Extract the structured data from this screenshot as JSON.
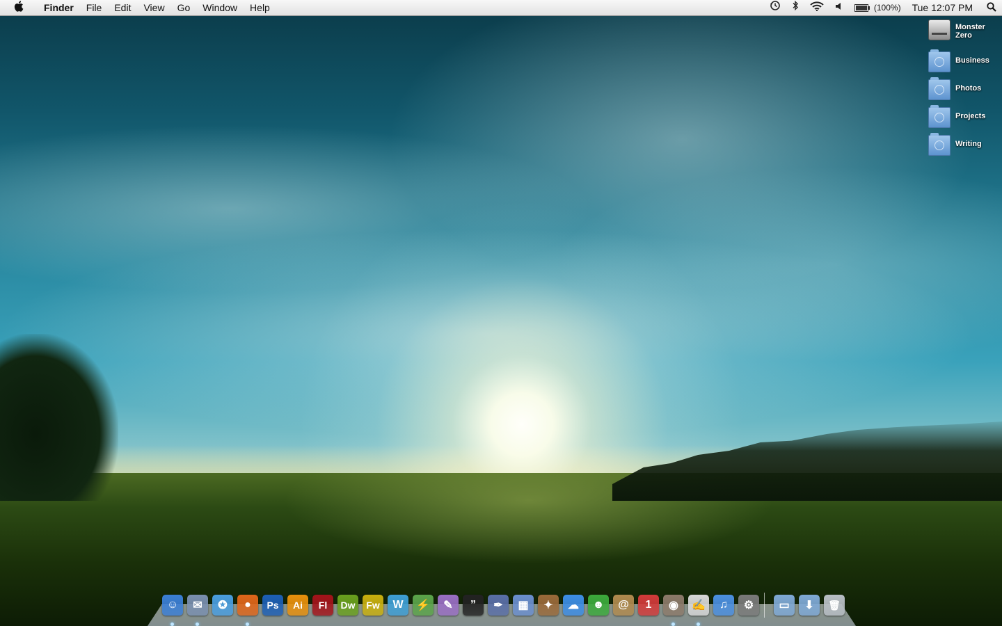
{
  "menubar": {
    "apple_icon": "apple-logo-icon",
    "app_name": "Finder",
    "menus": [
      "File",
      "Edit",
      "View",
      "Go",
      "Window",
      "Help"
    ],
    "status": {
      "time_machine_icon": "time-machine-icon",
      "bluetooth_icon": "bluetooth-icon",
      "wifi_icon": "wifi-icon",
      "volume_icon": "volume-icon",
      "battery_icon": "battery-icon",
      "battery_percent": "(100%)",
      "battery_level": 1.0,
      "clock": "Tue 12:07 PM",
      "spotlight_icon": "spotlight-icon"
    }
  },
  "desktop": {
    "items": [
      {
        "label": "Monster Zero",
        "kind": "hard-disk"
      },
      {
        "label": "Business",
        "kind": "folder"
      },
      {
        "label": "Photos",
        "kind": "folder"
      },
      {
        "label": "Projects",
        "kind": "folder"
      },
      {
        "label": "Writing",
        "kind": "folder"
      }
    ]
  },
  "dock": {
    "apps": [
      {
        "icon": "finder-icon",
        "glyph": "☺",
        "color": "#3b7fd6",
        "running": true
      },
      {
        "icon": "mail-icon",
        "glyph": "✉",
        "color": "#7a8fb0",
        "running": true
      },
      {
        "icon": "safari-icon",
        "glyph": "✪",
        "color": "#4a9ee0",
        "running": false
      },
      {
        "icon": "firefox-icon",
        "glyph": "●",
        "color": "#e0661a",
        "running": true
      },
      {
        "icon": "photoshop-icon",
        "glyph": "Ps",
        "color": "#1d5fb5",
        "running": false
      },
      {
        "icon": "illustrator-icon",
        "glyph": "Ai",
        "color": "#e8900c",
        "running": false
      },
      {
        "icon": "flash-icon",
        "glyph": "Fl",
        "color": "#a3131a",
        "running": false
      },
      {
        "icon": "dreamweaver-icon",
        "glyph": "Dw",
        "color": "#6aa01e",
        "running": false
      },
      {
        "icon": "fireworks-icon",
        "glyph": "Fw",
        "color": "#c9b00e",
        "running": false
      },
      {
        "icon": "coda-icon",
        "glyph": "W",
        "color": "#3e9fd6",
        "running": false
      },
      {
        "icon": "transmit-icon",
        "glyph": "⚡",
        "color": "#5ba44a",
        "running": false
      },
      {
        "icon": "textmate-icon",
        "glyph": "✎",
        "color": "#9a6fc4",
        "running": false
      },
      {
        "icon": "quote-icon",
        "glyph": "”",
        "color": "#222222",
        "running": false
      },
      {
        "icon": "script-editor-icon",
        "glyph": "✒",
        "color": "#5a6fa8",
        "running": false
      },
      {
        "icon": "keynote-icon",
        "glyph": "▦",
        "color": "#6b8fcf",
        "running": false
      },
      {
        "icon": "sparrow-icon",
        "glyph": "✦",
        "color": "#9a6a3a",
        "running": false
      },
      {
        "icon": "ichat-icon",
        "glyph": "☁",
        "color": "#3d8ee6",
        "running": false
      },
      {
        "icon": "adium-icon",
        "glyph": "☻",
        "color": "#3caa3c",
        "running": false
      },
      {
        "icon": "address-book-icon",
        "glyph": "@",
        "color": "#b08a4e",
        "running": false
      },
      {
        "icon": "ical-icon",
        "glyph": "1",
        "color": "#d23a3a",
        "running": false
      },
      {
        "icon": "preview-icon",
        "glyph": "◉",
        "color": "#8c7a6a",
        "running": true
      },
      {
        "icon": "textedit-icon",
        "glyph": "✍",
        "color": "#d8d8d8",
        "running": true
      },
      {
        "icon": "itunes-icon",
        "glyph": "♫",
        "color": "#4b8fe0",
        "running": false
      },
      {
        "icon": "system-preferences-icon",
        "glyph": "⚙",
        "color": "#7a7a7a",
        "running": false
      }
    ],
    "stacks": [
      {
        "icon": "applications-folder-icon",
        "glyph": "▭",
        "color": "#7fa9d6"
      },
      {
        "icon": "downloads-folder-icon",
        "glyph": "⬇",
        "color": "#7fa9d6"
      },
      {
        "icon": "trash-icon",
        "glyph": "🗑",
        "color": "#b9bfc6"
      }
    ]
  }
}
